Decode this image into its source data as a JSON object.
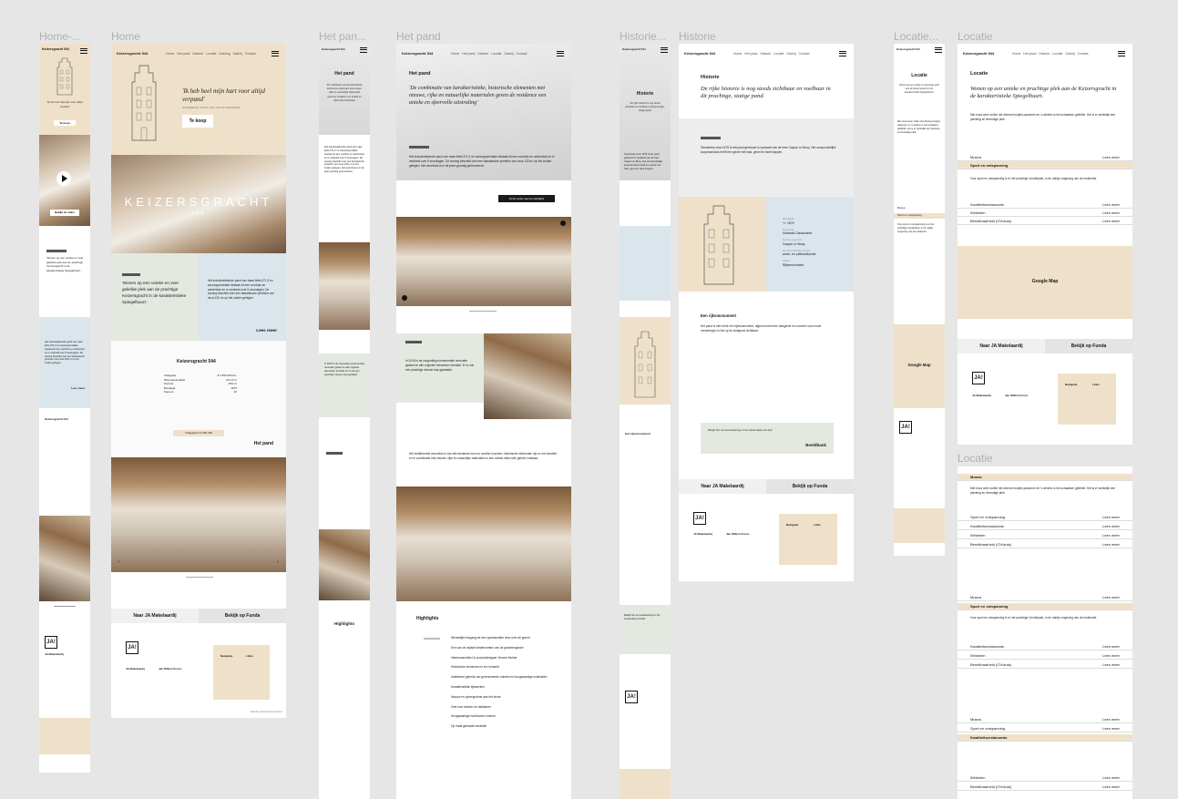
{
  "frames": {
    "home_mobile": "Home-...",
    "home": "Home",
    "pand_mobile": "Het pan...",
    "pand": "Het pand",
    "historie_mobile": "Historie...",
    "historie": "Historie",
    "locatie_mobile": "Locatie...",
    "locatie": "Locatie",
    "locatie2": "Locatie"
  },
  "site": {
    "brand": "Keizersgracht 544",
    "nav": [
      "Home",
      "Het pand",
      "Historie",
      "Locatie",
      "Indeling",
      "Galerij",
      "Contact"
    ],
    "hero_title": "KEIZERSGRACHT",
    "hero_number": "544",
    "logo": "JA!",
    "footer_agency": "JA Makelaardij",
    "footer_agent": "Jan Willem Kroon",
    "footer_cols": [
      "Navigatie",
      "Links"
    ],
    "copyright": "Website ontwikkeld door Dijkers"
  },
  "home": {
    "quote": "'Ik heb heel mijn hart voor altijd verpand'",
    "quote_sub": "WAARDEVOL PAND, HET OLD DUIVENDOOR",
    "cta": "Te koop",
    "video_btn": "Bekijk de video",
    "intro_quote": "'Wonen op een unieke en zeer geliefde plek aan de prachtige Keizersgracht in de karakteristieke Spiegelbuurt.'",
    "intro_text": "Het indrukwekkende pand van maar liefst 371,3 m² woonoppervlakte bestaat uit een voorhuis en achterhuis en is verdeeld over 5 woonlagen. De woning beschikt over een fantastische privétuin van circa 133 m² op het zuiden gelegen.",
    "lees_meer": "Lees meer",
    "card_title": "Keizersgracht 544",
    "card_rows": [
      [
        "Vraagprijs",
        "€ 4.950.000 k.k."
      ],
      [
        "Woonoppervlakte",
        "371,3 m²"
      ],
      [
        "Perceel",
        "253 m²"
      ],
      [
        "Bouwjaar",
        "1675"
      ],
      [
        "Kamers",
        "10"
      ]
    ],
    "card_btn": "Vraagprijs € 4.950.000",
    "het_pand_link": "Het pand",
    "naar_ja": "Naar JA Makelaardij",
    "funda": "Bekijk op Funda"
  },
  "pand": {
    "title": "Het pand",
    "quote": "'De combinatie van karakteristieke, historische elementen met nieuwe, rijke en natuurlijke materialen geven de residence een unieke en sfeervolle uitstraling'",
    "text1": "Het indrukwekkende pand van maar liefst 371,3 m² woonoppervlakte bestaat uit een voorhuis en achterhuis en is verdeeld over 5 woonlagen. De woning beschikt over een fantastische privétuin van circa 133 m² op het zuiden gelegen. Het woonhuis is in de jaren grondig gerenoveerd.",
    "btn_highlights": "Scroll verder naar de highlights",
    "green_text": "In 2015 is de zorgvuldig monumentale renovatie gestart en alle originele elementen hersteld. Er is ook een prachtige nieuwe trap geplaatst.",
    "text2": "Het schitterende woonhuis is van alle denkbare luxe en comfort voorzien, historische elementen zijn in ere hersteld en in combinatie met nieuwe, rijke en natuurlijke materialen is een unieke sfeervolle geheel ontstaan.",
    "highlights_title": "Highlights",
    "highlights": [
      "Wenselijke toegang tot een spectaculaire view over de gracht",
      "Een van de wijdste kelderruimten van de grachtengordel",
      "Interieurarchitect & productdesigner Vincent Mulder",
      "Historische elementen in ere hersteld",
      "Uitstekend gebruik van gerenoveerde ruimtes en hoogwaardige materialen",
      "Karakteristieke lijstwerken",
      "Inbouw en opbergruimte aan het einde",
      "Zeer luxe keuken en badkamer",
      "Hoogwaardige hardhouten vloeren",
      "Op maat gemaakt meubilair"
    ]
  },
  "historie": {
    "title": "Historie",
    "quote": "De rijke historie is nog steeds zichtbaar en voelbaar in dit prachtige, statige pand.",
    "text": "Omstreeks circa 1675 is het pand gebouwd in opdracht van de heer Caspar Le Bocq. Het oorspronkelijke koopmanshuis heeft een gevel met hals, gevel en twee trappen.",
    "facts": [
      [
        "Bouwjaar",
        "+/- 1675"
      ],
      [
        "Bouwstijl",
        "Hollands Classicisme"
      ],
      [
        "Eerste eigenaar",
        "Caspar Le Bocq"
      ],
      [
        "Oorspronkelijke functie",
        "woon- en pakhuisfunctie"
      ],
      [
        "Status",
        "Rijksmonument"
      ]
    ],
    "section_title": "Een rijksmonument",
    "section_text": "Het pand is met recht een rijksmonument, afgerond met een halsgevel en voorzien van mooie versieringen in het op de sluitgevel zichtbaar.",
    "archief_quote": "Bekijk hier de bouwtekening in het Amsterdams Archief",
    "archief_btn": "Beeldbank"
  },
  "locatie": {
    "title": "Locatie",
    "quote": "Wonen op een unieke en prachtige plek aan de Keizersgracht in de karakteristieke Spiegelbuurt.",
    "text": "Met mooi weer zullen het diverse bootjes passeren en 's winters is het schaatsen geliefde. Het is er werkelijk een plezierig en levendige plek.",
    "map_label": "Google Map",
    "rows": [
      "Musea",
      "Sport en ontspanning",
      "Kwaliteitsrestaurants",
      "Winkelen",
      "Bereikbaarheid (OV/auto)"
    ],
    "row_link": "Lees meer",
    "sport_text": "Voor sport en ontspanning is er het prachtige Vondelpark, in de nabije omgeving van de residentie."
  }
}
